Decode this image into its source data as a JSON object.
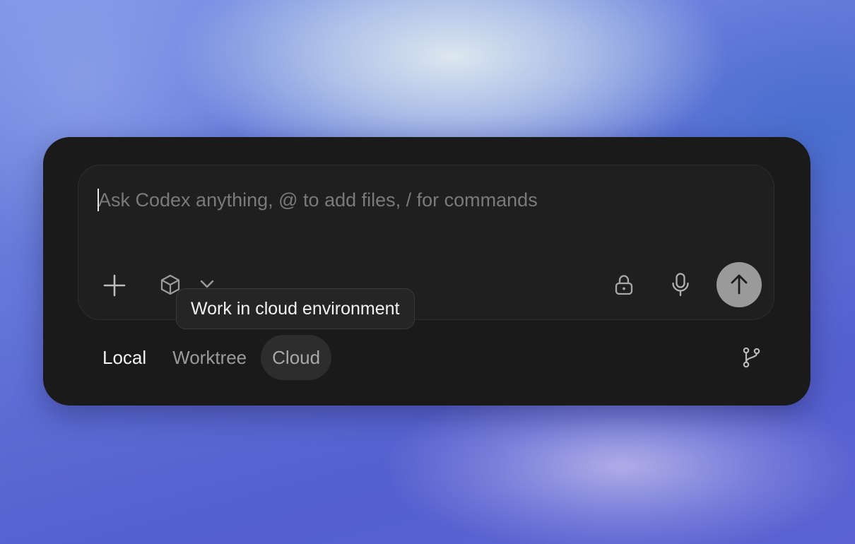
{
  "composer": {
    "placeholder": "Ask Codex anything, @ to add files, / for commands",
    "value": ""
  },
  "toolbar": {
    "left": [
      {
        "icon": "plus-icon",
        "label": "Add"
      },
      {
        "icon": "cube-icon",
        "label": "Environment"
      },
      {
        "icon": "chevron-down-icon",
        "label": "Environment menu"
      }
    ],
    "right": [
      {
        "icon": "lock-icon",
        "label": "Permissions"
      },
      {
        "icon": "microphone-icon",
        "label": "Voice input"
      },
      {
        "icon": "arrow-up-icon",
        "label": "Send"
      }
    ]
  },
  "tooltip": {
    "text": "Work in cloud environment"
  },
  "mode_tabs": {
    "items": [
      {
        "id": "local",
        "label": "Local",
        "active": true
      },
      {
        "id": "worktree",
        "label": "Worktree",
        "active": false
      },
      {
        "id": "cloud",
        "label": "Cloud",
        "hovered": true
      }
    ]
  },
  "branch_icon": "git-branch-icon",
  "colors": {
    "panel_bg": "#1a1a1a",
    "composer_bg": "#1f1f1f",
    "send_button": "#9a9a9a",
    "placeholder_text": "#7a7a7a",
    "active_tab_text": "#f2f2f2",
    "inactive_tab_text": "#9a9a9a"
  }
}
